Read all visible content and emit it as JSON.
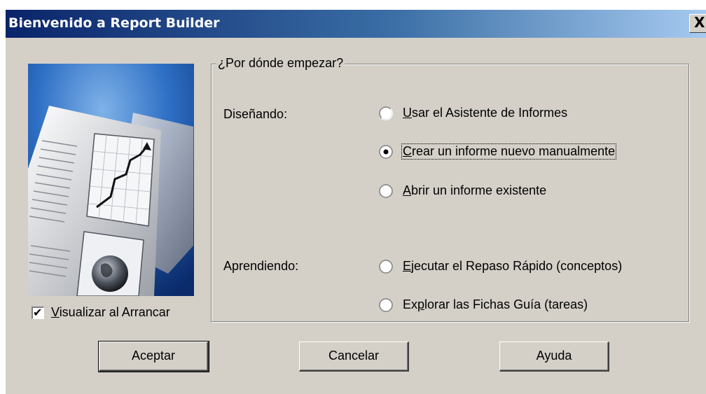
{
  "window": {
    "title": "Bienvenido a Report Builder",
    "close_glyph": "X",
    "titlebar_colors": [
      "#0a246a",
      "#a6caf0"
    ]
  },
  "illustration": {
    "icon": "report-chart-globe-illustration"
  },
  "startup_checkbox": {
    "checked": true,
    "mark": "✔",
    "accel": "V",
    "label_rest": "isualizar al Arrancar"
  },
  "group": {
    "legend": "¿Por dónde empezar?",
    "designing_label": "Diseñando:",
    "learning_label": "Aprendiendo:",
    "options": [
      {
        "before": "",
        "accel": "U",
        "after": "sar el Asistente de Informes",
        "checked": false
      },
      {
        "before": "",
        "accel": "C",
        "after": "rear un informe nuevo manualmente",
        "checked": true
      },
      {
        "before": "",
        "accel": "A",
        "after": "brir un informe existente",
        "checked": false
      },
      {
        "before": "",
        "accel": "E",
        "after": "jecutar el Repaso Rápido (conceptos)",
        "checked": false
      },
      {
        "before": "Ex",
        "accel": "p",
        "after": "lorar las Fichas Guía (tareas)",
        "checked": false
      }
    ]
  },
  "buttons": {
    "ok": "Aceptar",
    "cancel": "Cancelar",
    "help": "Ayuda"
  }
}
